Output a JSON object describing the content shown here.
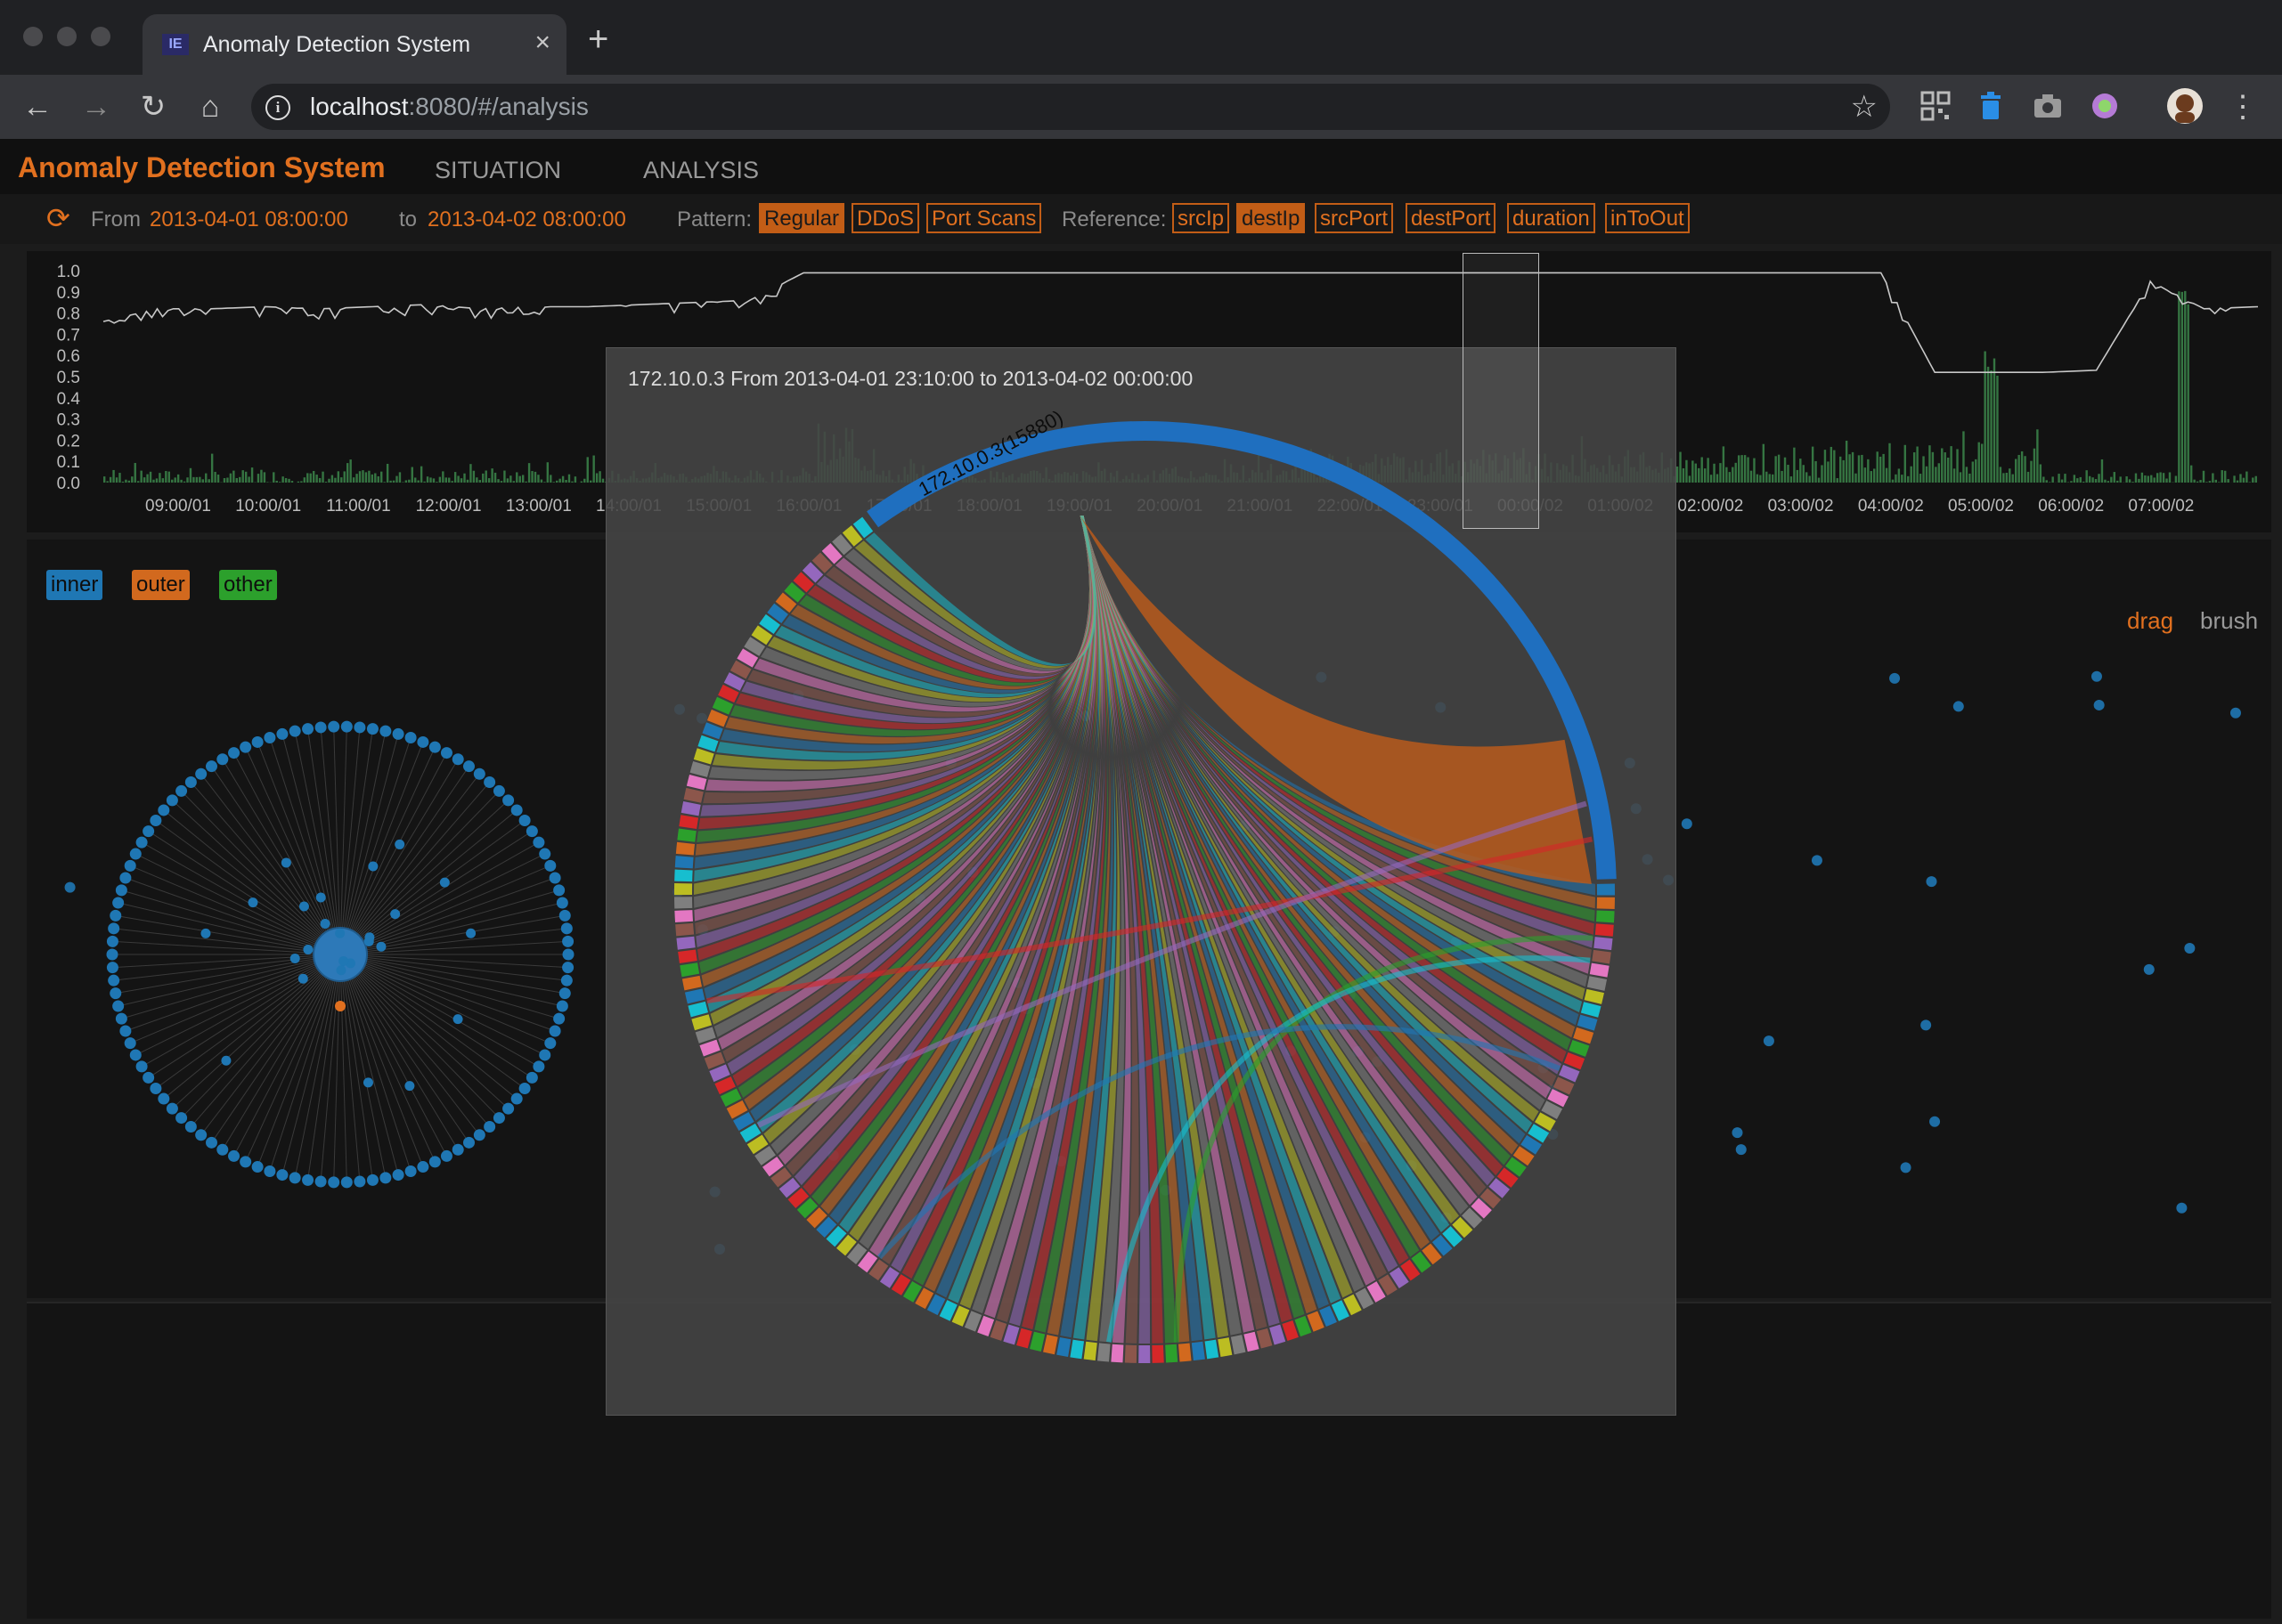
{
  "browser": {
    "tab_title": "Anomaly Detection System",
    "tab_close": "×",
    "new_tab": "+",
    "url_host": "localhost",
    "url_rest": ":8080/#/analysis",
    "nav_back": "←",
    "nav_forward": "→",
    "nav_reload": "↻",
    "nav_home": "⌂",
    "bookmark": "☆",
    "menu": "⋮"
  },
  "app": {
    "brand": "Anomaly Detection System",
    "menu": [
      "SITUATION",
      "ANALYSIS"
    ]
  },
  "filter": {
    "from_label": "From",
    "from_value": "2013-04-01 08:00:00",
    "to_label": "to",
    "to_value": "2013-04-02 08:00:00",
    "pattern_label": "Pattern:",
    "patterns": [
      {
        "label": "Regular",
        "active": true
      },
      {
        "label": "DDoS",
        "active": false
      },
      {
        "label": "Port Scans",
        "active": false
      }
    ],
    "reference_label": "Reference:",
    "references": [
      {
        "label": "srcIp",
        "active": false
      },
      {
        "label": "destIp",
        "active": true
      },
      {
        "label": "srcPort",
        "active": false
      },
      {
        "label": "destPort",
        "active": false
      },
      {
        "label": "duration",
        "active": false
      },
      {
        "label": "inToOut",
        "active": false
      }
    ]
  },
  "legend": [
    {
      "label": "inner",
      "color": "#1f77b4"
    },
    {
      "label": "outer",
      "color": "#d2691e"
    },
    {
      "label": "other",
      "color": "#2ca02c"
    }
  ],
  "modes": {
    "drag": "drag",
    "brush": "brush"
  },
  "colors": {
    "accent": "#e1701f",
    "inner": "#1f77b4",
    "outer": "#d2691e",
    "other": "#2ca02c"
  },
  "overlay": {
    "title": "172.10.0.3 From 2013-04-01 23:10:00 to 2013-04-02 00:00:00",
    "focus_label": "172.10.0.3(15880)"
  },
  "chart_data": {
    "type": "line",
    "yticks": [
      "1.0",
      "0.9",
      "0.8",
      "0.7",
      "0.6",
      "0.5",
      "0.4",
      "0.3",
      "0.2",
      "0.1",
      "0.0"
    ],
    "ylim": [
      0,
      1
    ],
    "xticks": [
      "09:00/01",
      "10:00/01",
      "11:00/01",
      "12:00/01",
      "13:00/01",
      "14:00/01",
      "15:00/01",
      "16:00/01",
      "17:00/01",
      "18:00/01",
      "19:00/01",
      "20:00/01",
      "21:00/01",
      "22:00/01",
      "23:00/01",
      "00:00/02",
      "01:00/02",
      "02:00/02",
      "03:00/02",
      "04:00/02",
      "05:00/02",
      "06:00/02",
      "07:00/02"
    ],
    "series": [
      {
        "values": [
          0.76,
          0.82,
          0.82,
          0.83,
          0.82,
          0.83,
          0.84,
          0.82,
          0.83,
          0.83,
          0.84,
          0.85,
          0.86,
          0.99,
          0.99,
          0.99,
          0.99,
          0.99,
          0.99,
          0.99,
          0.99,
          0.99,
          0.99,
          0.99,
          0.99,
          0.99,
          0.99,
          0.99,
          0.99,
          0.99,
          0.99,
          0.99,
          0.99,
          0.99,
          0.52,
          0.52,
          0.52,
          0.53,
          0.95,
          0.82,
          0.83
        ]
      }
    ]
  }
}
